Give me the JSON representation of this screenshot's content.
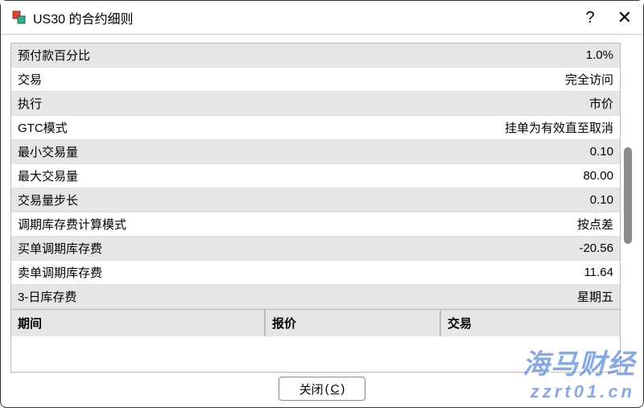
{
  "window": {
    "title": "US30 的合约细则"
  },
  "rows": [
    {
      "label": "预付款百分比",
      "value": "1.0%"
    },
    {
      "label": "交易",
      "value": "完全访问"
    },
    {
      "label": "执行",
      "value": "市价"
    },
    {
      "label": "GTC模式",
      "value": "挂单为有效直至取消"
    },
    {
      "label": "最小交易量",
      "value": "0.10"
    },
    {
      "label": "最大交易量",
      "value": "80.00"
    },
    {
      "label": "交易量步长",
      "value": "0.10"
    },
    {
      "label": "调期库存费计算模式",
      "value": "按点差"
    },
    {
      "label": "买单调期库存费",
      "value": "-20.56"
    },
    {
      "label": "卖单调期库存费",
      "value": "11.64"
    },
    {
      "label": "3-日库存费",
      "value": "星期五"
    }
  ],
  "columns": {
    "c1": "期间",
    "c2": "报价",
    "c3": "交易"
  },
  "footer": {
    "close_label": "关闭",
    "close_accel": "C"
  },
  "watermark": {
    "line1": "海马财经",
    "line2": "zzrt01.cn"
  }
}
